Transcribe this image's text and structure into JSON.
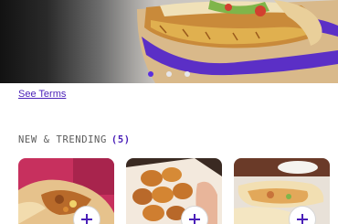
{
  "hero": {
    "image_icon": "crunchwrap-hero-image",
    "slides_total": 3,
    "active_slide": 1
  },
  "links": {
    "see_terms": "See Terms"
  },
  "section": {
    "title": "NEW & TRENDING",
    "count": "(5)"
  },
  "cards": [
    {
      "image_icon": "burrito-image",
      "add_icon": "plus-icon"
    },
    {
      "image_icon": "nuggets-image",
      "add_icon": "plus-icon"
    },
    {
      "image_icon": "wrap-image",
      "add_icon": "plus-icon"
    }
  ],
  "colors": {
    "accent": "#4a1fb8",
    "active_dot": "#5a2ee0",
    "heading": "#5b5b5b"
  }
}
